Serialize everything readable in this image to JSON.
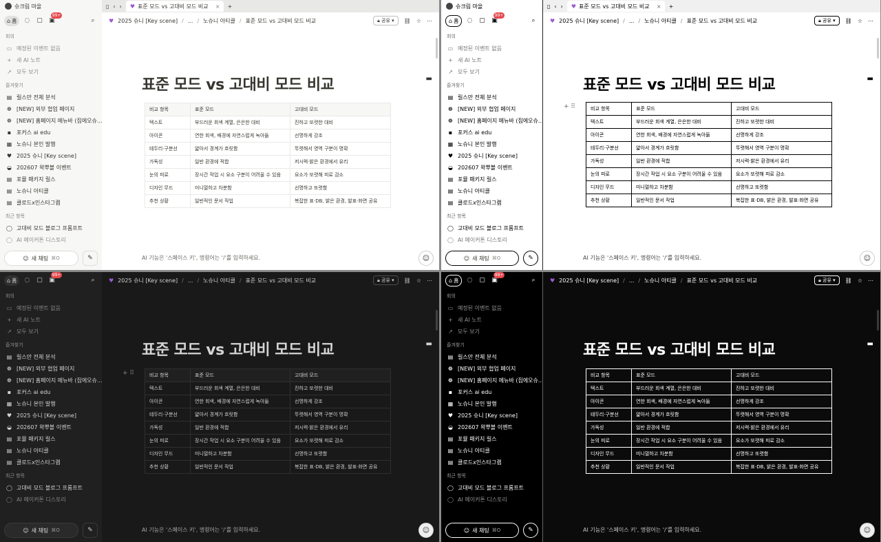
{
  "window": {
    "workspace": "슈크림 마을"
  },
  "tab": {
    "label": "표준 모드 vs 고대비 모드 비교",
    "new_tab": "+"
  },
  "sidebar": {
    "home": "홈",
    "badge": "99+",
    "meetings_header": "회의",
    "meetings": [
      {
        "label": "예정된 이벤트 없음",
        "icon": "calendar-icon",
        "glyph": "▭"
      },
      {
        "label": "새 AI 노트",
        "icon": "plus-icon",
        "glyph": "+"
      },
      {
        "label": "모두 보기",
        "icon": "arrow-icon",
        "glyph": "↗"
      }
    ],
    "favorites_header": "즐겨찾기",
    "favorites": [
      {
        "label": "릴스만 전체 분석",
        "glyph": "▤"
      },
      {
        "label": "[NEW] 외부 협업 페이지",
        "glyph": "❁"
      },
      {
        "label": "[NEW] 홈페이지 메뉴바 (집에오슈...",
        "glyph": "❁"
      },
      {
        "label": "포커스 ai edu",
        "glyph": "▪"
      },
      {
        "label": "노슈니 본인 발행",
        "glyph": "▦"
      },
      {
        "label": "2025 슈니 [Key scene]",
        "glyph": "♥"
      },
      {
        "label": "202607 왁뿌볼 이벤트",
        "glyph": "◒"
      },
      {
        "label": "포뮬 패키지 릴스",
        "glyph": "▤"
      },
      {
        "label": "노슈니 아티클",
        "glyph": "▤"
      },
      {
        "label": "클로드x인스타그램",
        "glyph": "▤"
      }
    ],
    "recent_header": "최근 항목",
    "recent": [
      {
        "label": "고대비 모드 블로그 프롬프트",
        "glyph": "◯"
      },
      {
        "label": "AI 메이커톤 디스토리",
        "glyph": "◯"
      }
    ],
    "new_chat": "새 채팅",
    "new_chat_kbd": "⌘O"
  },
  "breadcrumb": {
    "root": "2025 슈니 [Key scene]",
    "ellipsis": "...",
    "parent": "노슈니 아티클",
    "current": "표준 모드 vs 고대비 모드 비교",
    "share": "공유"
  },
  "page": {
    "title": "표준 모드 vs 고대비 모드 비교",
    "table_header": [
      "비교 항목",
      "표준 모드",
      "고대비 모드"
    ],
    "table_rows": [
      [
        "텍스트",
        "부드러운 회색 계열, 은은한 대비",
        "진하고 또렷한 대비"
      ],
      [
        "아이콘",
        "연한 회색, 배경에 자연스럽게 녹아듦",
        "선명하게 강조"
      ],
      [
        "테두리·구분선",
        "얇아서 경계가 흐릿함",
        "뚜렷해서 영역 구분이 명확"
      ],
      [
        "가독성",
        "일반 환경에 적합",
        "저시력·밝은 환경에서 유리"
      ],
      [
        "눈의 피로",
        "장시간 작업 시 요소 구분이 어려울 수 있음",
        "요소가 또렷해 피로 감소"
      ],
      [
        "디자인 무드",
        "미니멀하고 차분함",
        "선명하고 또렷함"
      ],
      [
        "추천 상황",
        "일반적인 문서 작업",
        "복잡한 표·DB, 밝은 환경, 발표·화면 공유"
      ]
    ],
    "ai_hint": "AI 기능은 '스페이스 키', 명령어는 '/'를 입력하세요."
  },
  "theme_colors": {
    "light_bg": "#ffffff",
    "light_sidebar": "#f7f7f5",
    "dark_bg": "#191919",
    "dark_sidebar": "#202020",
    "highcontrast_dark_bg": "#000000",
    "badge": "#e5484d",
    "accent_heart": "#9b59d0"
  }
}
